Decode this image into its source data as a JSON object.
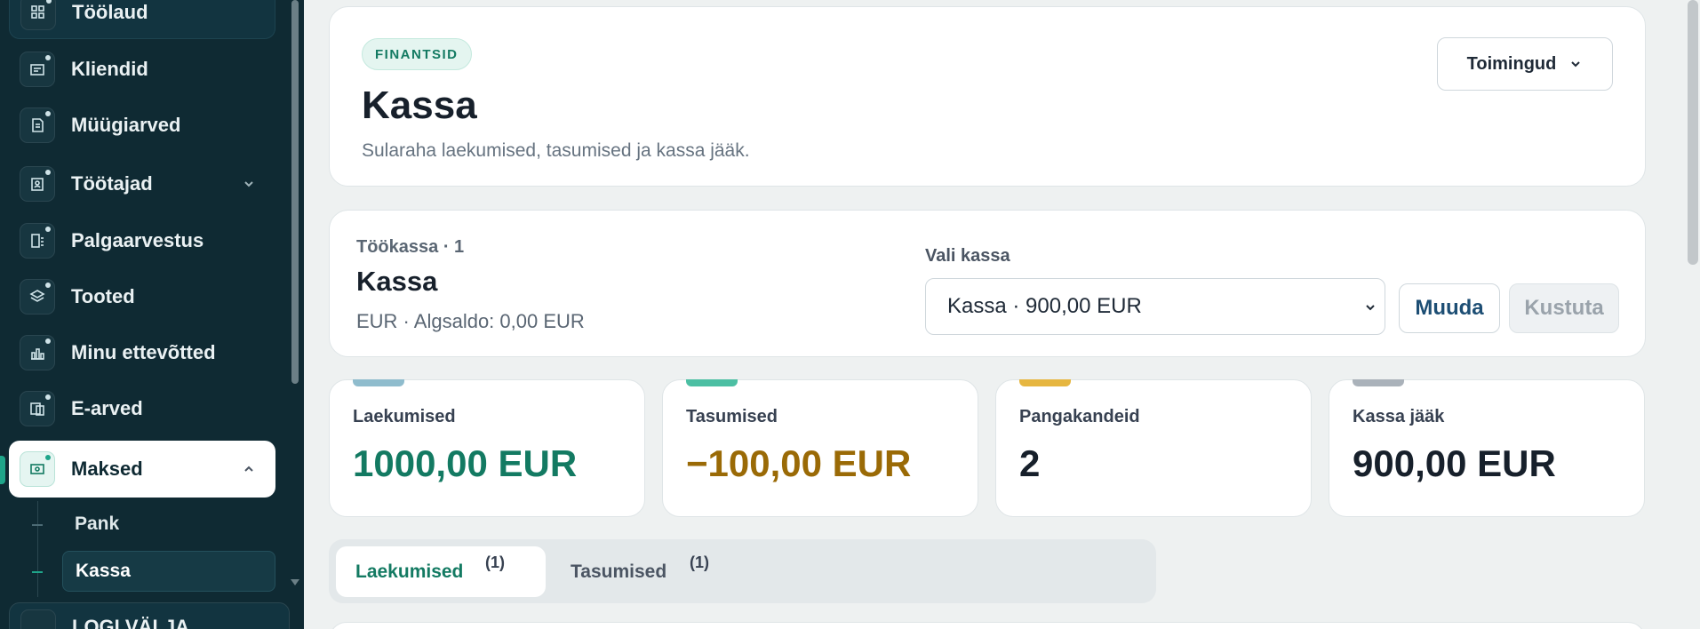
{
  "sidebar": {
    "items": [
      {
        "label": "Töölaud",
        "icon": "dashboard-icon"
      },
      {
        "label": "Kliendid",
        "icon": "clients-icon"
      },
      {
        "label": "Müügiarved",
        "icon": "invoice-icon"
      },
      {
        "label": "Töötajad",
        "icon": "employees-icon"
      },
      {
        "label": "Palgaarvestus",
        "icon": "payroll-icon"
      },
      {
        "label": "Tooted",
        "icon": "layers-icon"
      },
      {
        "label": "Minu ettevõtted",
        "icon": "companies-icon"
      },
      {
        "label": "E-arved",
        "icon": "e-invoice-icon"
      },
      {
        "label": "Maksed",
        "icon": "payments-icon"
      }
    ],
    "sub_items": [
      {
        "label": "Pank"
      },
      {
        "label": "Kassa"
      }
    ],
    "bottom_label": "LOGI VÄLJA"
  },
  "header": {
    "badge": "FINANTSID",
    "title": "Kassa",
    "subtitle": "Sularaha laekumised, tasumised ja kassa jääk.",
    "actions_label": "Toimingud"
  },
  "register": {
    "meta": "Töökassa · 1",
    "name": "Kassa",
    "info": "EUR · Algsaldo: 0,00 EUR",
    "select_label": "Vali kassa",
    "select_value": "Kassa · 900,00 EUR",
    "edit_label": "Muuda",
    "delete_label": "Kustuta"
  },
  "stats": [
    {
      "label": "Laekumised",
      "value": "1000,00 EUR",
      "color": "#137a62",
      "accent": "#8fbccd"
    },
    {
      "label": "Tasumised",
      "value": "−100,00 EUR",
      "color": "#9a6a06",
      "accent": "#4cbfa3"
    },
    {
      "label": "Pangakandeid",
      "value": "2",
      "color": "#17202b",
      "accent": "#e6b640"
    },
    {
      "label": "Kassa jääk",
      "value": "900,00 EUR",
      "color": "#17202b",
      "accent": "#aab2ba"
    }
  ],
  "tabs": [
    {
      "label": "Laekumised",
      "count": "(1)"
    },
    {
      "label": "Tasumised",
      "count": "(1)"
    }
  ]
}
